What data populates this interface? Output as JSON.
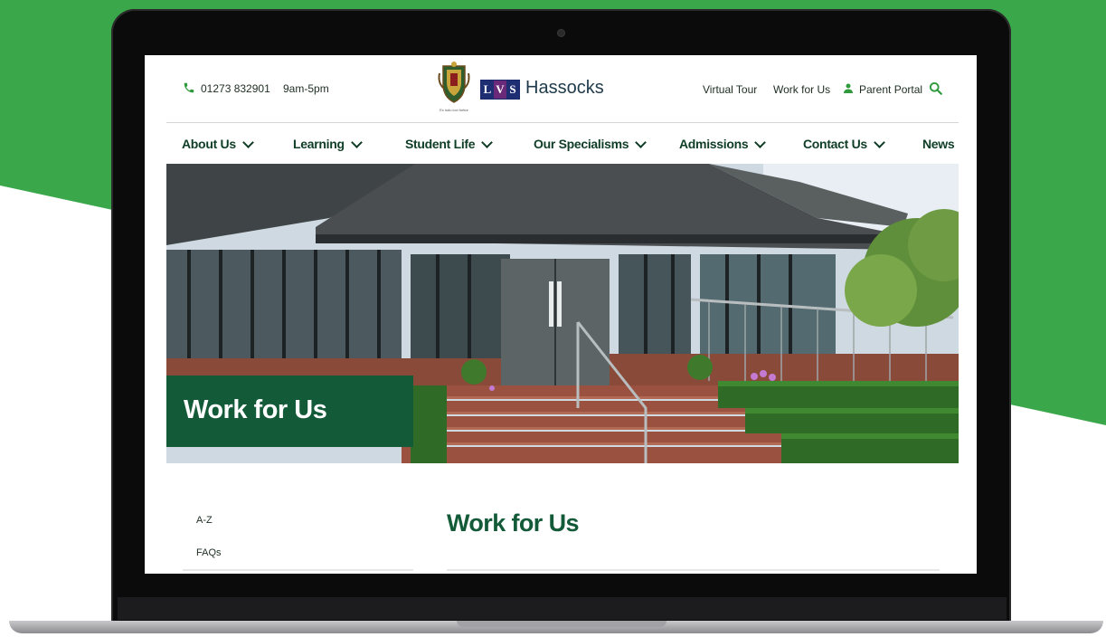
{
  "header": {
    "phone": "01273 832901",
    "hours": "9am-5pm",
    "brand_initials": [
      "L",
      "V",
      "S"
    ],
    "brand_name": "Hassocks",
    "crest_motto": "Ex ludo loci fortior",
    "utility_links": [
      "Virtual Tour",
      "Work for Us",
      "Parent Portal"
    ]
  },
  "nav": {
    "items": [
      "About Us",
      "Learning",
      "Student Life",
      "Our Specialisms",
      "Admissions",
      "Contact Us",
      "News"
    ]
  },
  "hero": {
    "title": "Work for Us"
  },
  "sidebar": {
    "links": [
      "A-Z",
      "FAQs"
    ]
  },
  "main": {
    "heading": "Work for Us"
  },
  "colors": {
    "backdrop_green": "#3aa84a",
    "brand_dark_green": "#135a38",
    "nav_text": "#0f3d26",
    "accent_icon": "#2f9a3c"
  },
  "icons": [
    "phone-icon",
    "crest-icon",
    "user-icon",
    "search-icon",
    "chevron-down-icon"
  ]
}
